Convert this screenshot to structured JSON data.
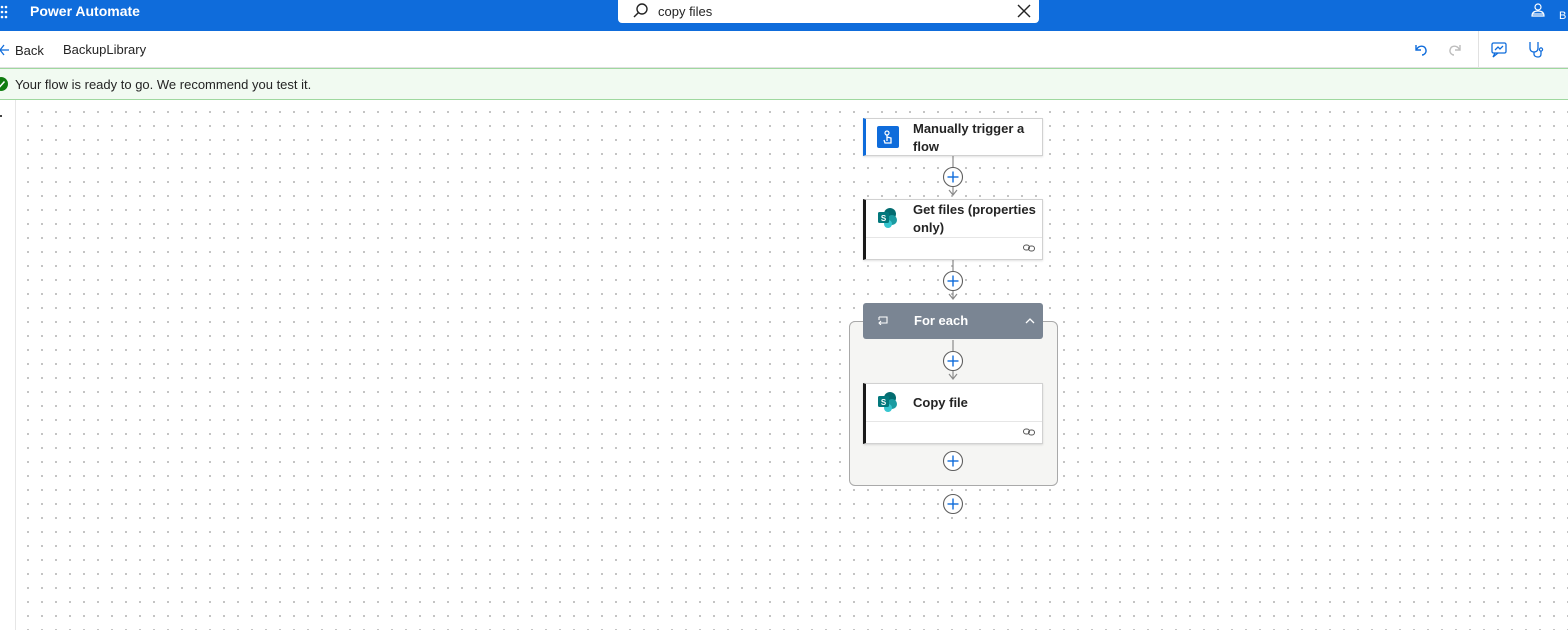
{
  "topbar": {
    "app_title": "Power Automate",
    "search_value": "copy files",
    "env_letter_top": "",
    "env_letter_bottom": "B",
    "bg_color": "#0f6cdb"
  },
  "commandbar": {
    "back_label": "Back",
    "flow_name": "BackupLibrary",
    "icons": [
      "undo-icon",
      "redo-icon",
      "copilot-icon",
      "flow-checker-icon"
    ]
  },
  "notification": {
    "text": "Your flow is ready to go. We recommend you test it.",
    "status_color": "#107c10"
  },
  "flow": {
    "trigger": {
      "title": "Manually trigger a flow",
      "icon": "touch-trigger-icon",
      "accent": "#0f6cdb"
    },
    "get_files": {
      "title": "Get files (properties only)",
      "icon": "sharepoint-icon"
    },
    "for_each": {
      "title": "For each",
      "icon": "loop-icon",
      "collapsed": false
    },
    "copy_file": {
      "title": "Copy file",
      "icon": "sharepoint-icon"
    }
  }
}
